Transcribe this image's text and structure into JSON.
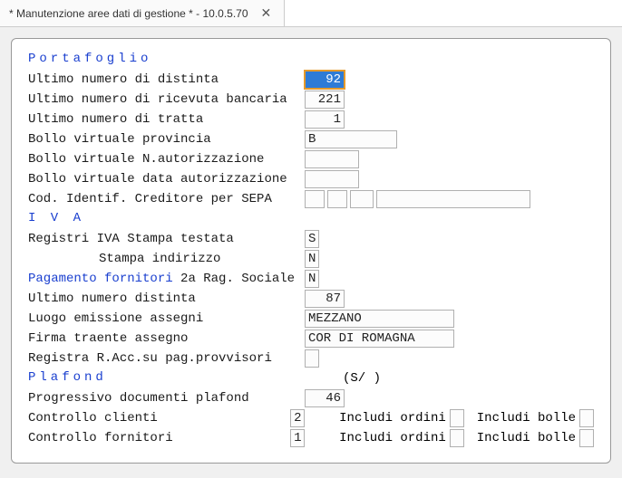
{
  "tab": {
    "title": "* Manutenzione aree dati di gestione *   -   10.0.5.70",
    "close": "✕"
  },
  "sections": {
    "portafoglio": "Portafoglio",
    "iva": "I V A",
    "plafond": "Plafond"
  },
  "fields": {
    "ultimo_num_distinta": {
      "label": "Ultimo numero di distinta",
      "value": "92"
    },
    "ultimo_num_ricevuta": {
      "label": "Ultimo numero di ricevuta bancaria",
      "value": "221"
    },
    "ultimo_num_tratta": {
      "label": "Ultimo numero di tratta",
      "value": "1"
    },
    "bollo_provincia": {
      "label": "Bollo virtuale provincia",
      "value": "B"
    },
    "bollo_autorizz": {
      "label": "Bollo virtuale N.autorizzazione",
      "value": ""
    },
    "bollo_data": {
      "label": "Bollo virtuale data autorizzazione",
      "value": ""
    },
    "cod_sepa": {
      "label": "Cod. Identif. Creditore per SEPA",
      "p1": "",
      "p2": "",
      "p3": "",
      "p4": ""
    },
    "registri_iva_testata": {
      "label": "Registri IVA Stampa testata",
      "value": "S"
    },
    "stampa_indirizzo": {
      "label": "Stampa indirizzo",
      "value": "N"
    },
    "pag_fornitori": {
      "label1": "Pagamento fornitori",
      "label2": " 2a Rag. Sociale",
      "value": "N"
    },
    "ultimo_num_distinta2": {
      "label": "Ultimo numero distinta",
      "value": "87"
    },
    "luogo_assegni": {
      "label": "Luogo emissione assegni",
      "value": "MEZZANO"
    },
    "firma_traente": {
      "label": "Firma traente assegno",
      "value": "COR DI ROMAGNA"
    },
    "registra_racc": {
      "label": "Registra R.Acc.su pag.provvisori",
      "value": ""
    },
    "plafond_suffix": "(S/ )",
    "progressivo_plafond": {
      "label": "Progressivo documenti plafond",
      "value": "46"
    },
    "controllo_clienti": {
      "label": "Controllo clienti",
      "value": "2",
      "includi_ordini": "Includi ordini",
      "ord_val": "",
      "includi_bolle": "Includi bolle",
      "bolle_val": ""
    },
    "controllo_fornitori": {
      "label": "Controllo fornitori",
      "value": "1",
      "includi_ordini": "Includi ordini",
      "ord_val": "",
      "includi_bolle": "Includi bolle",
      "bolle_val": ""
    }
  }
}
